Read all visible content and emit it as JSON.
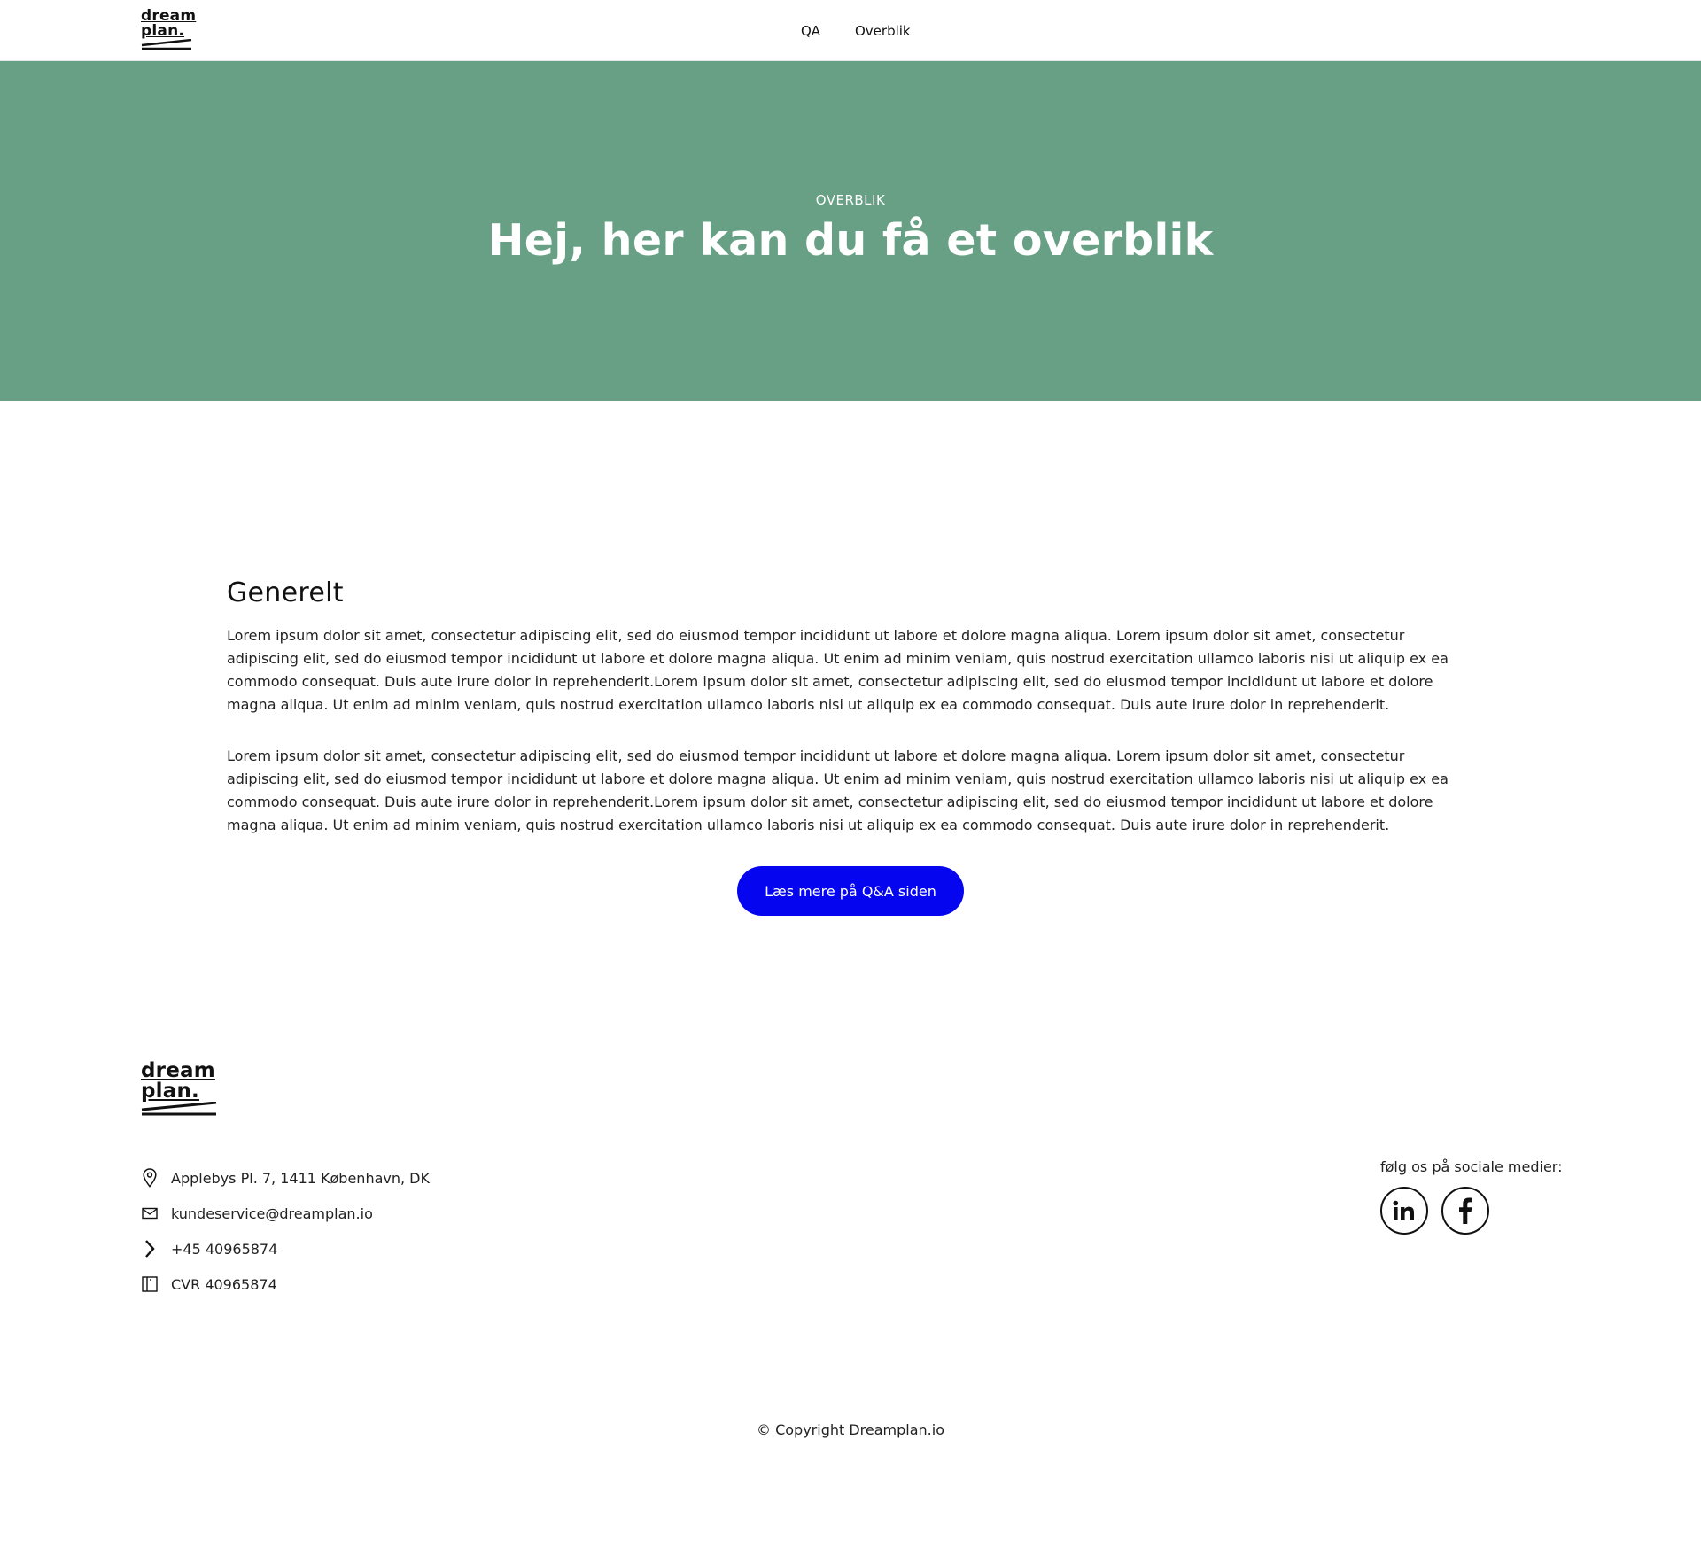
{
  "brand": {
    "logo_line1": "dream",
    "logo_line2": "plan."
  },
  "nav": {
    "items": [
      {
        "label": "QA"
      },
      {
        "label": "Overblik"
      }
    ]
  },
  "hero": {
    "eyebrow": "OVERBLIK",
    "title": "Hej, her kan du få et overblik",
    "background": "#67a084"
  },
  "content": {
    "heading": "Generelt",
    "paragraphs": [
      "Lorem ipsum dolor sit amet, consectetur adipiscing elit, sed do eiusmod tempor incididunt ut labore et dolore magna aliqua. Lorem ipsum dolor sit amet, consectetur adipiscing elit, sed do eiusmod tempor incididunt ut labore et dolore magna aliqua. Ut enim ad minim veniam, quis nostrud exercitation ullamco laboris nisi ut aliquip ex ea commodo consequat. Duis aute irure dolor in reprehenderit.Lorem ipsum dolor sit amet, consectetur adipiscing elit, sed do eiusmod tempor incididunt ut labore et dolore magna aliqua. Ut enim ad minim veniam, quis nostrud exercitation ullamco laboris nisi ut aliquip ex ea commodo consequat. Duis aute irure dolor in reprehenderit.",
      "Lorem ipsum dolor sit amet, consectetur adipiscing elit, sed do eiusmod tempor incididunt ut labore et dolore magna aliqua. Lorem ipsum dolor sit amet, consectetur adipiscing elit, sed do eiusmod tempor incididunt ut labore et dolore magna aliqua. Ut enim ad minim veniam, quis nostrud exercitation ullamco laboris nisi ut aliquip ex ea commodo consequat. Duis aute irure dolor in reprehenderit.Lorem ipsum dolor sit amet, consectetur adipiscing elit, sed do eiusmod tempor incididunt ut labore et dolore magna aliqua. Ut enim ad minim veniam, quis nostrud exercitation ullamco laboris nisi ut aliquip ex ea commodo consequat. Duis aute irure dolor in reprehenderit."
    ],
    "cta_label": "Læs mere på Q&A siden",
    "cta_color": "#0505f0"
  },
  "footer": {
    "contact": [
      {
        "icon": "location-pin-icon",
        "text": "Applebys Pl. 7, 1411 København, DK"
      },
      {
        "icon": "mail-icon",
        "text": "kundeservice@dreamplan.io"
      },
      {
        "icon": "chevron-right-icon",
        "text": "+45 40965874"
      },
      {
        "icon": "building-icon",
        "text": "CVR 40965874"
      }
    ],
    "social_label": "følg os på sociale medier:",
    "social": [
      {
        "icon": "linkedin-icon"
      },
      {
        "icon": "facebook-icon"
      }
    ],
    "copyright": "© Copyright Dreamplan.io"
  }
}
